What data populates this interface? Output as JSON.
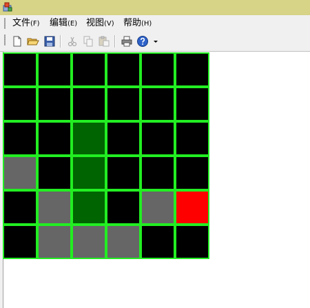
{
  "window": {
    "icon": "app-icon",
    "colors": {
      "titlebar": "#d7d387",
      "chrome": "#f0f0f0"
    }
  },
  "menu": [
    {
      "label": "文件",
      "accel": "(F)"
    },
    {
      "label": "编辑",
      "accel": "(E)"
    },
    {
      "label": "视图",
      "accel": "(V)"
    },
    {
      "label": "帮助",
      "accel": "(H)"
    }
  ],
  "toolbar": {
    "buttons": [
      {
        "icon": "new-file-icon",
        "enabled": true
      },
      {
        "icon": "open-folder-icon",
        "enabled": true
      },
      {
        "icon": "save-icon",
        "enabled": true
      },
      {
        "icon": "cut-icon",
        "enabled": false
      },
      {
        "icon": "copy-icon",
        "enabled": false
      },
      {
        "icon": "paste-icon",
        "enabled": false
      },
      {
        "icon": "print-icon",
        "enabled": true
      },
      {
        "icon": "help-icon",
        "enabled": true
      }
    ]
  },
  "board": {
    "rows": 6,
    "cols": 6,
    "colors": {
      "black": "#000000",
      "green": "#006400",
      "gray": "#666666",
      "red": "#ff0000",
      "border": "#22ee22"
    },
    "cells": [
      [
        "black",
        "black",
        "black",
        "black",
        "black",
        "black"
      ],
      [
        "black",
        "black",
        "black",
        "black",
        "black",
        "black"
      ],
      [
        "black",
        "black",
        "green",
        "black",
        "black",
        "black"
      ],
      [
        "gray",
        "black",
        "green",
        "black",
        "black",
        "black"
      ],
      [
        "black",
        "gray",
        "green",
        "black",
        "gray",
        "red"
      ],
      [
        "black",
        "gray",
        "gray",
        "gray",
        "black",
        "black"
      ]
    ]
  }
}
